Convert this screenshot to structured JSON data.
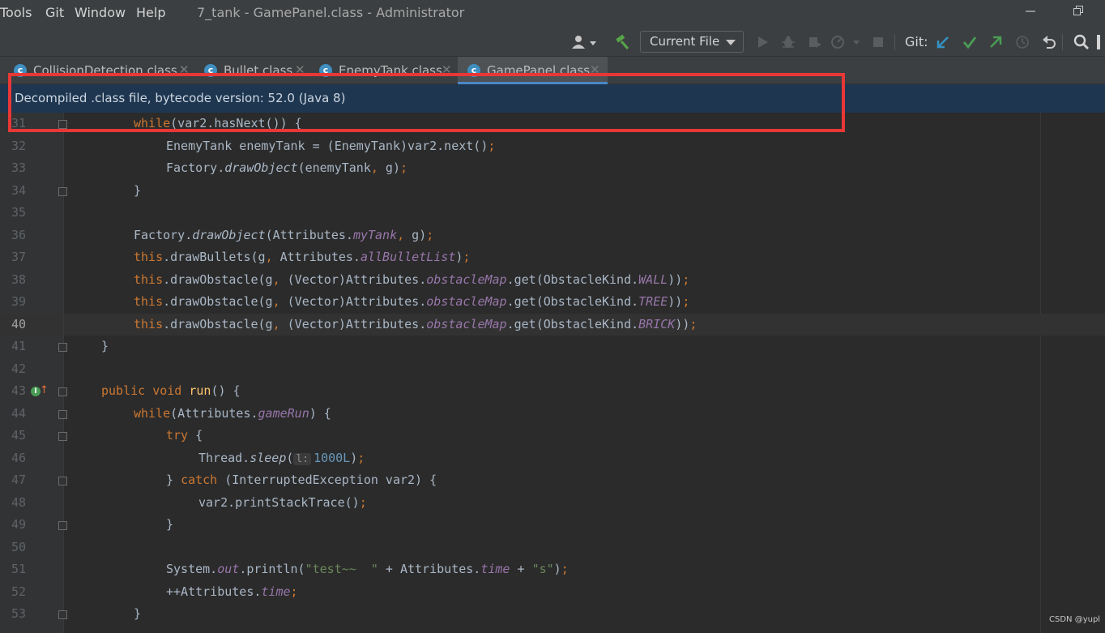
{
  "menu": {
    "items": [
      "Tools",
      "Git",
      "Window",
      "Help"
    ],
    "title": "7_tank - GamePanel.class - Administrator"
  },
  "toolbar": {
    "run_config": "Current File",
    "git_label": "Git:",
    "icons": [
      "user-icon",
      "build-hammer-icon",
      "run-icon",
      "debug-icon",
      "coverage-icon",
      "profile-icon",
      "stop-icon",
      "git-update-icon",
      "git-commit-icon",
      "git-push-icon",
      "history-icon",
      "rollback-icon",
      "search-icon"
    ]
  },
  "tabs": [
    {
      "label": "CollisionDetection.class",
      "active": false
    },
    {
      "label": "Bullet.class",
      "active": false
    },
    {
      "label": "EnemyTank.class",
      "active": false
    },
    {
      "label": "GamePanel.class",
      "active": true
    }
  ],
  "banner": {
    "text": "Decompiled .class file, bytecode version: 52.0 (Java 8)"
  },
  "editor": {
    "current_line": "40",
    "lines": [
      {
        "n": "31",
        "code": "while(var2.hasNext()) {"
      },
      {
        "n": "32",
        "code": "EnemyTank enemyTank = (EnemyTank)var2.next();"
      },
      {
        "n": "33",
        "code": "Factory.drawObject(enemyTank, g);"
      },
      {
        "n": "34",
        "code": "}"
      },
      {
        "n": "35",
        "code": ""
      },
      {
        "n": "36",
        "code": "Factory.drawObject(Attributes.myTank, g);"
      },
      {
        "n": "37",
        "code": "this.drawBullets(g, Attributes.allBulletList);"
      },
      {
        "n": "38",
        "code": "this.drawObstacle(g, (Vector)Attributes.obstacleMap.get(ObstacleKind.WALL));"
      },
      {
        "n": "39",
        "code": "this.drawObstacle(g, (Vector)Attributes.obstacleMap.get(ObstacleKind.TREE));"
      },
      {
        "n": "40",
        "code": "this.drawObstacle(g, (Vector)Attributes.obstacleMap.get(ObstacleKind.BRICK));"
      },
      {
        "n": "41",
        "code": "}"
      },
      {
        "n": "42",
        "code": ""
      },
      {
        "n": "43",
        "code": "public void run() {"
      },
      {
        "n": "44",
        "code": "while(Attributes.gameRun) {"
      },
      {
        "n": "45",
        "code": "try {"
      },
      {
        "n": "46",
        "code": "Thread.sleep(l: 1000L);"
      },
      {
        "n": "47",
        "code": "} catch (InterruptedException var2) {"
      },
      {
        "n": "48",
        "code": "var2.printStackTrace();"
      },
      {
        "n": "49",
        "code": "}"
      },
      {
        "n": "50",
        "code": ""
      },
      {
        "n": "51",
        "code": "System.out.println(\"test~~  \" + Attributes.time + \"s\");"
      },
      {
        "n": "52",
        "code": "++Attributes.time;"
      },
      {
        "n": "53",
        "code": "}"
      }
    ]
  },
  "watermark": "CSDN @yupl"
}
